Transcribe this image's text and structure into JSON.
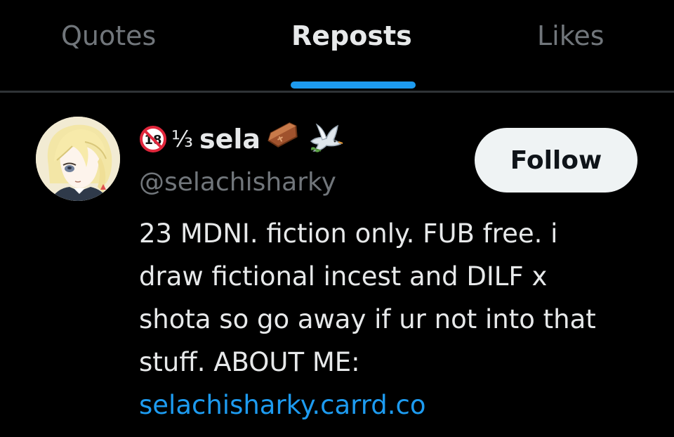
{
  "tabs": {
    "items": [
      {
        "label": "Quotes",
        "active": false
      },
      {
        "label": "Reposts",
        "active": true
      },
      {
        "label": "Likes",
        "active": false
      }
    ]
  },
  "user": {
    "badge_icon": "no-under-18-icon",
    "pronouns": "⅓",
    "name": "sela",
    "name_emojis": [
      "coffin-icon",
      "dove-icon"
    ],
    "handle": "@selachisharky",
    "follow_label": "Follow",
    "bio_lines": [
      "23 MDNI. fiction only. FUB free. i",
      "draw fictional incest and DILF x",
      "shota so go away if ur not into that",
      "stuff. ABOUT ME:"
    ],
    "bio_link": "selachisharky.carrd.co"
  },
  "colors": {
    "background": "#000000",
    "text": "#e7e9ea",
    "muted": "#71767b",
    "accent": "#1d9bf0",
    "divider": "#2f3336",
    "button_bg": "#eff3f4"
  }
}
